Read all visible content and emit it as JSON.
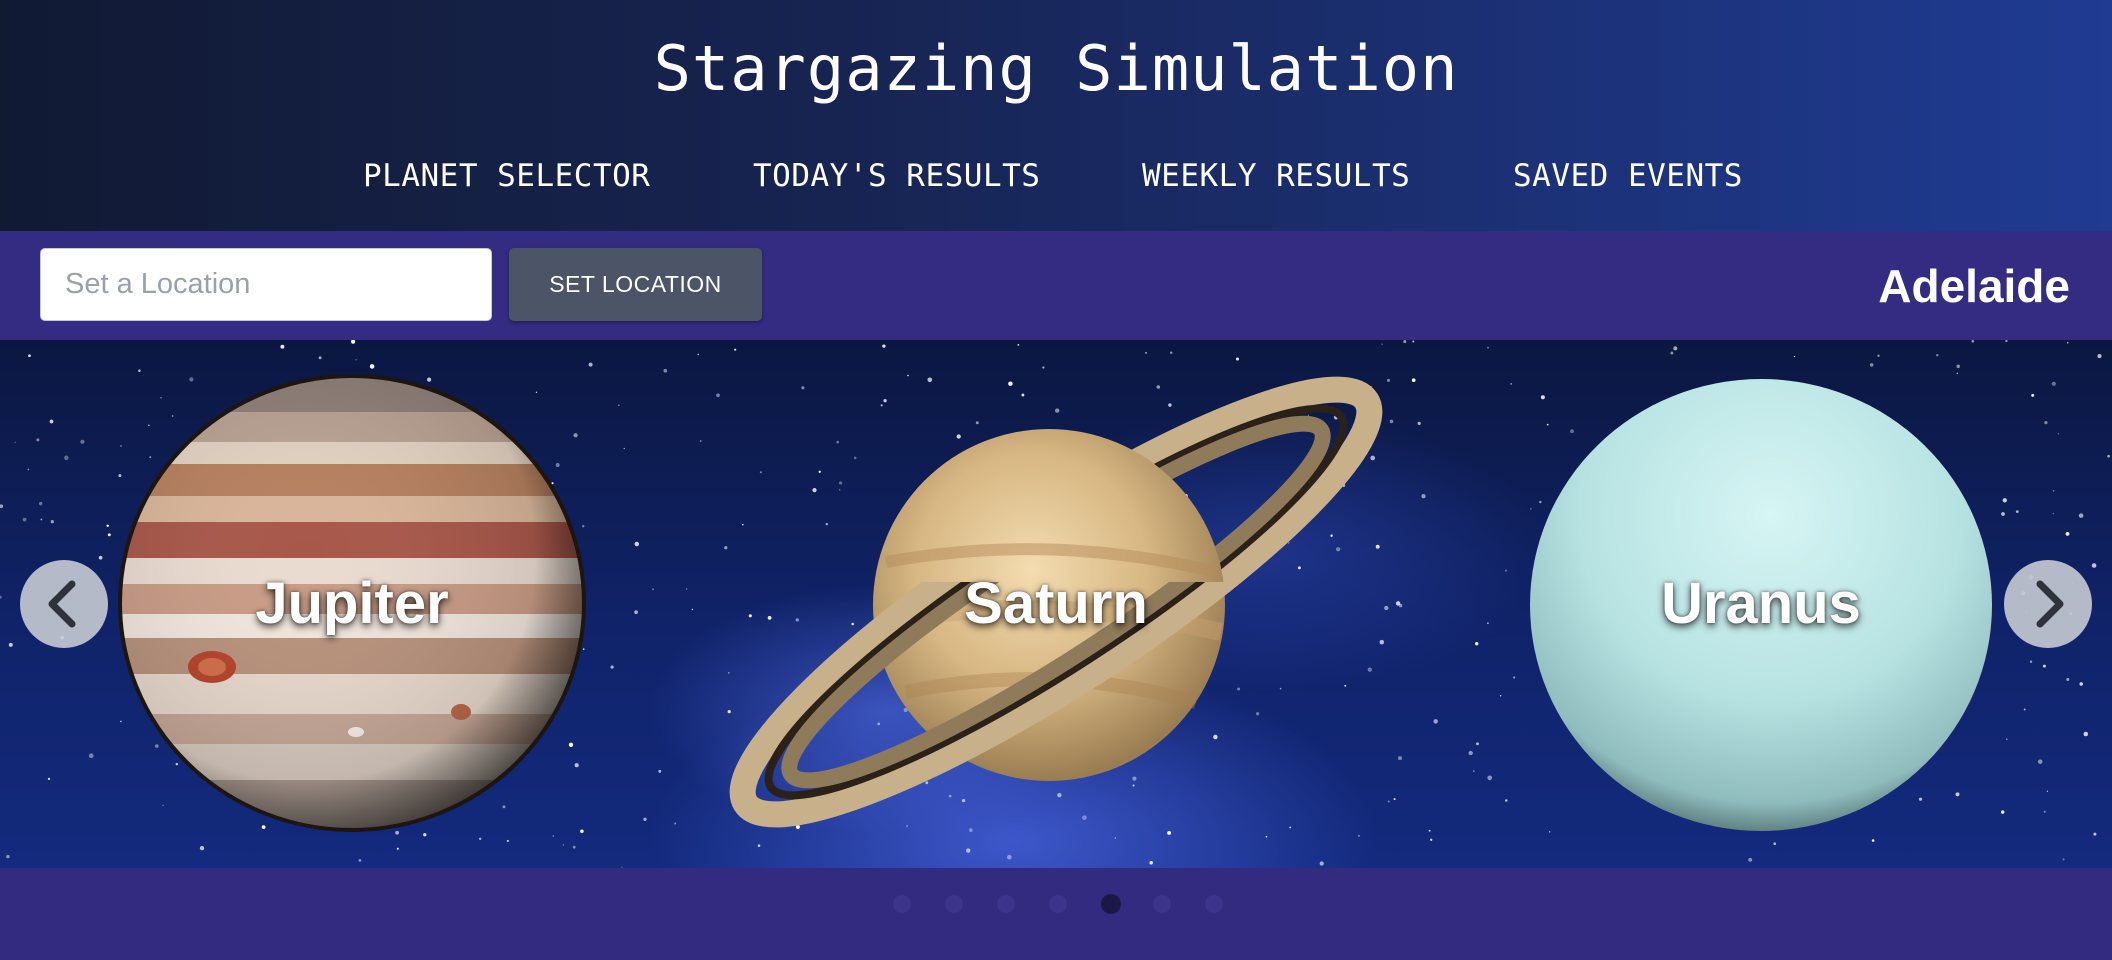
{
  "header": {
    "title": "Stargazing Simulation",
    "nav": [
      {
        "label": "PLANET SELECTOR"
      },
      {
        "label": "TODAY'S RESULTS"
      },
      {
        "label": "WEEKLY RESULTS"
      },
      {
        "label": "SAVED EVENTS"
      }
    ]
  },
  "location": {
    "placeholder": "Set a Location",
    "value": "",
    "button_label": "SET LOCATION",
    "current": "Adelaide"
  },
  "carousel": {
    "planets": [
      {
        "name": "Jupiter"
      },
      {
        "name": "Saturn"
      },
      {
        "name": "Uranus"
      }
    ],
    "prev_icon": "chevron-left-icon",
    "next_icon": "chevron-right-icon",
    "indicator_count": 7,
    "active_indicator": 5
  },
  "colors": {
    "header_start": "#111a33",
    "header_end": "#1f3b92",
    "location_bar": "#342c82",
    "button": "#4b5567",
    "space": "#10236a"
  }
}
